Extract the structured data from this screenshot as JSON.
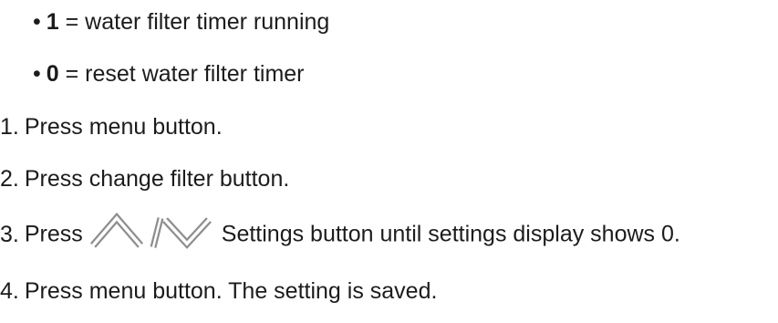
{
  "bullets": [
    {
      "dot": "•",
      "key": "1",
      "separator": " = ",
      "text": "water filter timer running"
    },
    {
      "dot": "•",
      "key": "0",
      "separator": " = ",
      "text": "reset water filter timer"
    }
  ],
  "steps": [
    {
      "number": "1.",
      "text": "Press menu button."
    },
    {
      "number": "2.",
      "text": "Press change filter button."
    },
    {
      "number": "3.",
      "text_before": "Press",
      "icons": [
        "chevron-up-icon",
        "slash-icon",
        "chevron-down-icon"
      ],
      "text_after": "Settings button until settings display shows 0."
    },
    {
      "number": "4.",
      "text": "Press menu button. The setting is saved."
    }
  ]
}
